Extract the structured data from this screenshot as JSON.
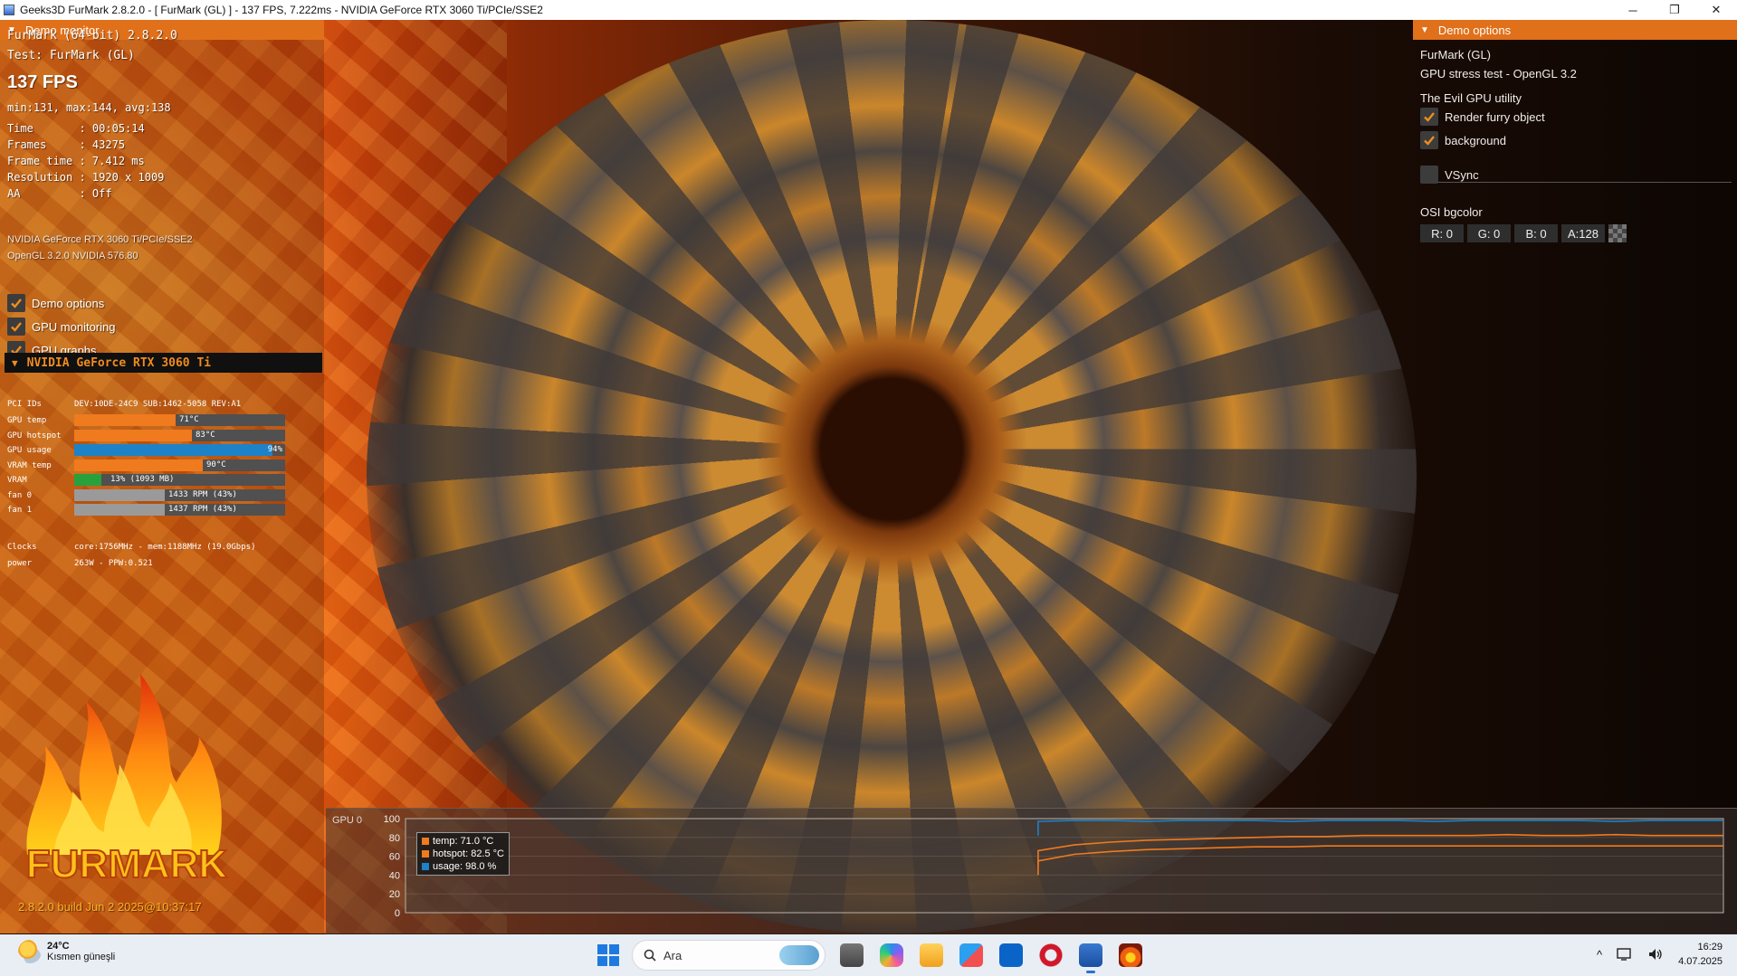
{
  "window": {
    "title": "Geeks3D FurMark 2.8.2.0 - [ FurMark (GL) ] - 137 FPS, 7.222ms - NVIDIA GeForce RTX 3060 Ti/PCIe/SSE2",
    "minimize_glyph": "─",
    "maximize_glyph": "❐",
    "close_glyph": "✕"
  },
  "monitor": {
    "header": "Demo monitor",
    "version": "FurMark (64-bit) 2.8.2.0",
    "test": "Test: FurMark (GL)",
    "fps": "137 FPS",
    "minmax": "min:131, max:144, avg:138",
    "stats": [
      "Time       : 00:05:14",
      "Frames     : 43275",
      "Frame time : 7.412 ms",
      "Resolution : 1920 x 1009",
      "AA         : Off"
    ],
    "gpu_name": "NVIDIA GeForce RTX 3060 Ti/PCIe/SSE2",
    "gl": "OpenGL 3.2.0 NVIDIA 576.80",
    "checkboxes": [
      {
        "label": "Demo options",
        "checked": true
      },
      {
        "label": "GPU monitoring",
        "checked": true
      },
      {
        "label": "GPU graphs",
        "checked": true
      }
    ]
  },
  "gpu_monitor": {
    "header": "NVIDIA GeForce RTX 3060 Ti",
    "pci_label": "PCI IDs",
    "pci_value": "DEV:10DE-24C9 SUB:1462-5058 REV:A1",
    "bars": [
      {
        "label": "GPU temp",
        "text": "71°C",
        "fraction": 0.48,
        "color": "#f07a1e"
      },
      {
        "label": "GPU hotspot",
        "text": "83°C",
        "fraction": 0.56,
        "color": "#f07a1e"
      },
      {
        "label": "GPU usage",
        "text": "94%",
        "fraction": 0.94,
        "color": "#1e82c8"
      },
      {
        "label": "VRAM temp",
        "text": "90°C",
        "fraction": 0.61,
        "color": "#f07a1e"
      },
      {
        "label": "VRAM",
        "text": "13% (1093 MB)",
        "fraction": 0.13,
        "color": "#28a03c"
      },
      {
        "label": "fan 0",
        "text": "1433 RPM (43%)",
        "fraction": 0.43,
        "color": "#9a9a9a"
      },
      {
        "label": "fan 1",
        "text": "1437 RPM (43%)",
        "fraction": 0.43,
        "color": "#9a9a9a"
      }
    ],
    "clocks_label": "Clocks",
    "clocks_value": "core:1756MHz - mem:1188MHz (19.0Gbps)",
    "power_label": "power",
    "power_value": "263W - PPW:0.521"
  },
  "logo": {
    "text": "FURMARK",
    "build": "2.8.2.0 build Jun  2 2025@10:37:17"
  },
  "options": {
    "header": "Demo options",
    "line1": "FurMark (GL)",
    "line2": "GPU stress test - OpenGL 3.2",
    "section": "The Evil GPU utility",
    "checkboxes": [
      {
        "label": "Render furry object",
        "checked": true
      },
      {
        "label": "background",
        "checked": true
      },
      {
        "label": "VSync",
        "checked": false
      }
    ],
    "bgcolor_label": "OSI bgcolor",
    "rgba": [
      "R: 0",
      "G: 0",
      "B: 0",
      "A:128"
    ]
  },
  "graph": {
    "title": "GPU 0",
    "y_ticks": [
      "100",
      "80",
      "60",
      "40",
      "20",
      "0"
    ],
    "legend": [
      {
        "label": "temp: 71.0 °C",
        "color": "#f07a1e"
      },
      {
        "label": "hotspot: 82.5 °C",
        "color": "#f07a1e"
      },
      {
        "label": "usage: 98.0 %",
        "color": "#1e82c8"
      }
    ]
  },
  "chart_data": {
    "type": "line",
    "ylim": [
      0,
      100
    ],
    "y_ticks": [
      100,
      80,
      60,
      40,
      20,
      0
    ],
    "start_fraction": 0.48,
    "series": [
      {
        "name": "temp",
        "color": "#f07a1e",
        "values": [
          55,
          62,
          65,
          67,
          68,
          69,
          70,
          70,
          71,
          71,
          71,
          71,
          71,
          71,
          71,
          71,
          71,
          71,
          71,
          71
        ]
      },
      {
        "name": "hotspot",
        "color": "#f07a1e",
        "values": [
          66,
          72,
          75,
          77,
          78,
          79,
          80,
          81,
          81,
          82,
          82,
          82,
          82,
          83,
          82,
          82,
          83,
          82,
          82,
          82
        ]
      },
      {
        "name": "usage",
        "color": "#1e82c8",
        "values": [
          97,
          98,
          98,
          97,
          98,
          98,
          98,
          97,
          98,
          98,
          98,
          97,
          98,
          98,
          98,
          98,
          97,
          98,
          98,
          98
        ]
      }
    ]
  },
  "taskbar": {
    "temperature": "24°C",
    "weather": "Kısmen güneşli",
    "search_placeholder": "Ara",
    "time": "16:29",
    "date": "4.07.2025"
  }
}
